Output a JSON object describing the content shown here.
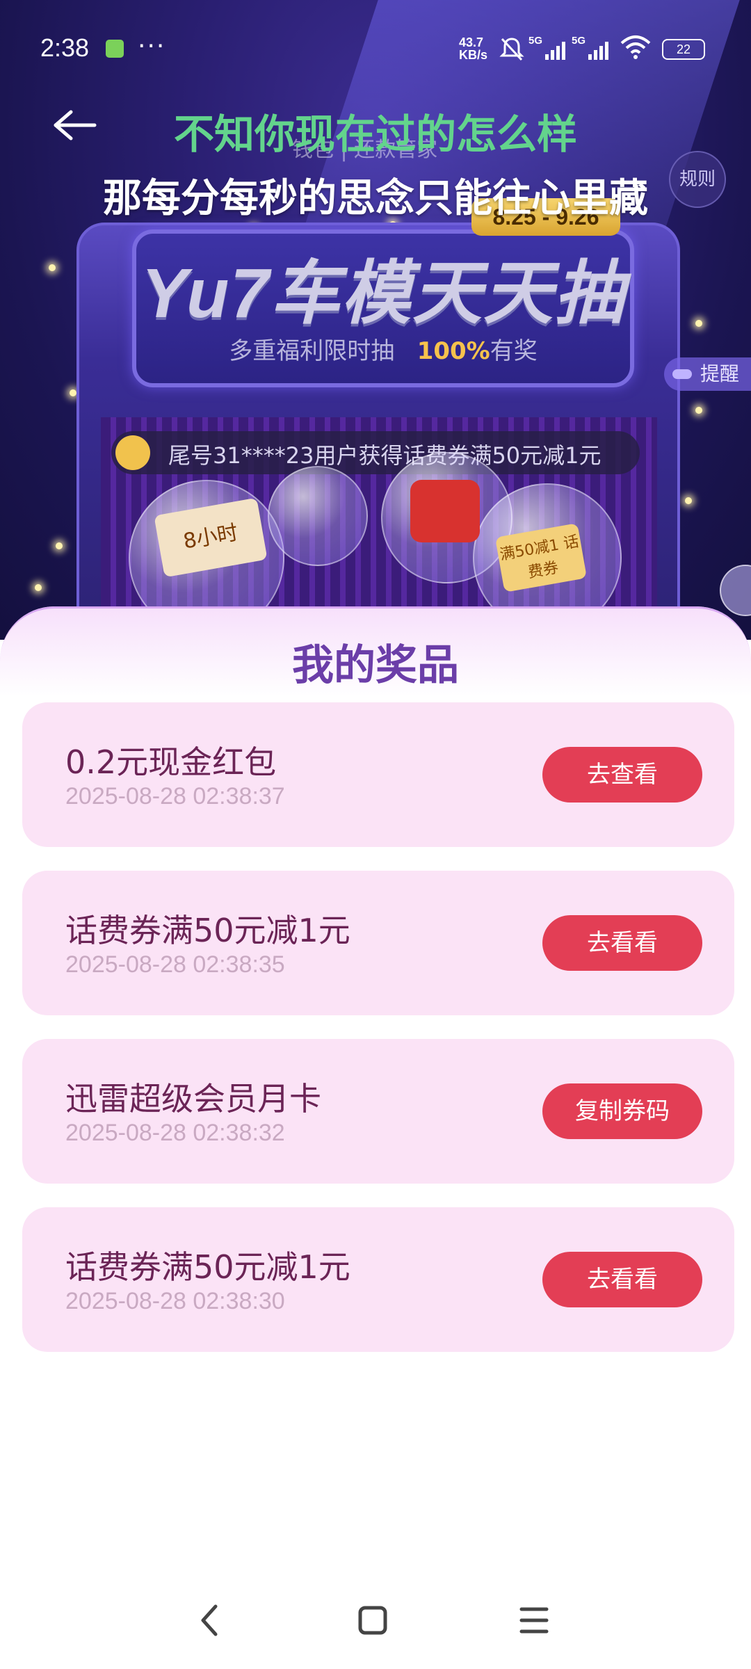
{
  "status_bar": {
    "time": "2:38",
    "more": "···",
    "net_speed_value": "43.7",
    "net_speed_unit": "KB/s",
    "signal1_label": "5G",
    "signal2_label": "5G",
    "battery": "22"
  },
  "header": {
    "wallet_text": "钱包 | 还款管家",
    "rules_label": "规则"
  },
  "lyrics": {
    "line1": "不知你现在过的怎么样",
    "line2": "那每分每秒的思念只能往心里藏"
  },
  "banner": {
    "date_range": "8.25 - 9.26",
    "title": "Yu7车模天天抽",
    "subtitle_prefix": "多重福利限时抽",
    "subtitle_highlight": "100%",
    "subtitle_suffix": "有奖",
    "remind_label": "提醒",
    "ticker": "尾号31****23用户获得话费券满50元减1元",
    "prize_a": "8小时",
    "prize_b": "满50减1 话费券"
  },
  "prizes": {
    "title": "我的奖品",
    "items": [
      {
        "name": "0.2元现金红包",
        "time": "2025-08-28 02:38:37",
        "action": "去查看"
      },
      {
        "name": "话费券满50元减1元",
        "time": "2025-08-28 02:38:35",
        "action": "去看看"
      },
      {
        "name": "迅雷超级会员月卡",
        "time": "2025-08-28 02:38:32",
        "action": "复制券码"
      },
      {
        "name": "话费券满50元减1元",
        "time": "2025-08-28 02:38:30",
        "action": "去看看"
      }
    ]
  },
  "colors": {
    "accent_button": "#e33e55",
    "card_bg": "#fbe3f6",
    "title_purple": "#6b3ea8",
    "lyric_green": "#63d48c"
  }
}
